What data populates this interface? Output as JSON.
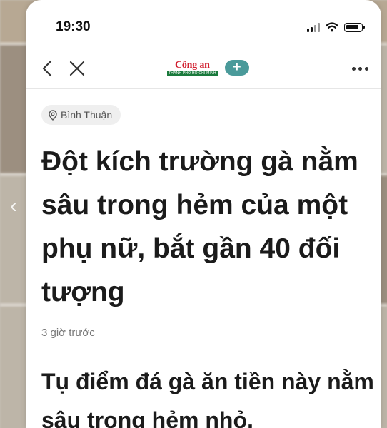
{
  "status_bar": {
    "time": "19:30"
  },
  "nav": {
    "brand_name": "Công an",
    "brand_sub": "THÀNH PHỐ HỒ CHÍ MINH",
    "follow_label": "+"
  },
  "article": {
    "location": "Bình Thuận",
    "headline": "Đột kích trường gà nằm sâu trong hẻm của một phụ nữ, bắt gần 40 đối tượng",
    "timestamp": "3 giờ trước",
    "lead": "Tụ điểm đá gà ăn tiền này nằm sâu trong hẻm nhỏ,"
  },
  "colors": {
    "brand_red": "#d1202f",
    "follow_teal": "#4a9a9a"
  },
  "icons": [
    "back-chevron-icon",
    "close-icon",
    "more-icon",
    "location-pin-icon",
    "signal-icon",
    "wifi-icon",
    "battery-icon"
  ]
}
